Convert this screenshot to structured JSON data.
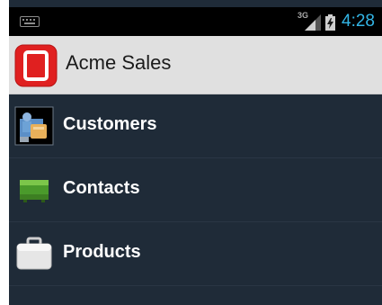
{
  "status_bar": {
    "network_label": "3G",
    "time": "4:28"
  },
  "action_bar": {
    "title": "Acme Sales",
    "icon": "acme-app-icon"
  },
  "menu": {
    "items": [
      {
        "label": "Customers",
        "icon": "customers-icon"
      },
      {
        "label": "Contacts",
        "icon": "contacts-icon"
      },
      {
        "label": "Products",
        "icon": "products-icon"
      }
    ]
  },
  "colors": {
    "background": "#1f2b38",
    "action_bar": "#e0e0e0",
    "app_icon": "#e02020",
    "clock": "#33b5e5"
  }
}
